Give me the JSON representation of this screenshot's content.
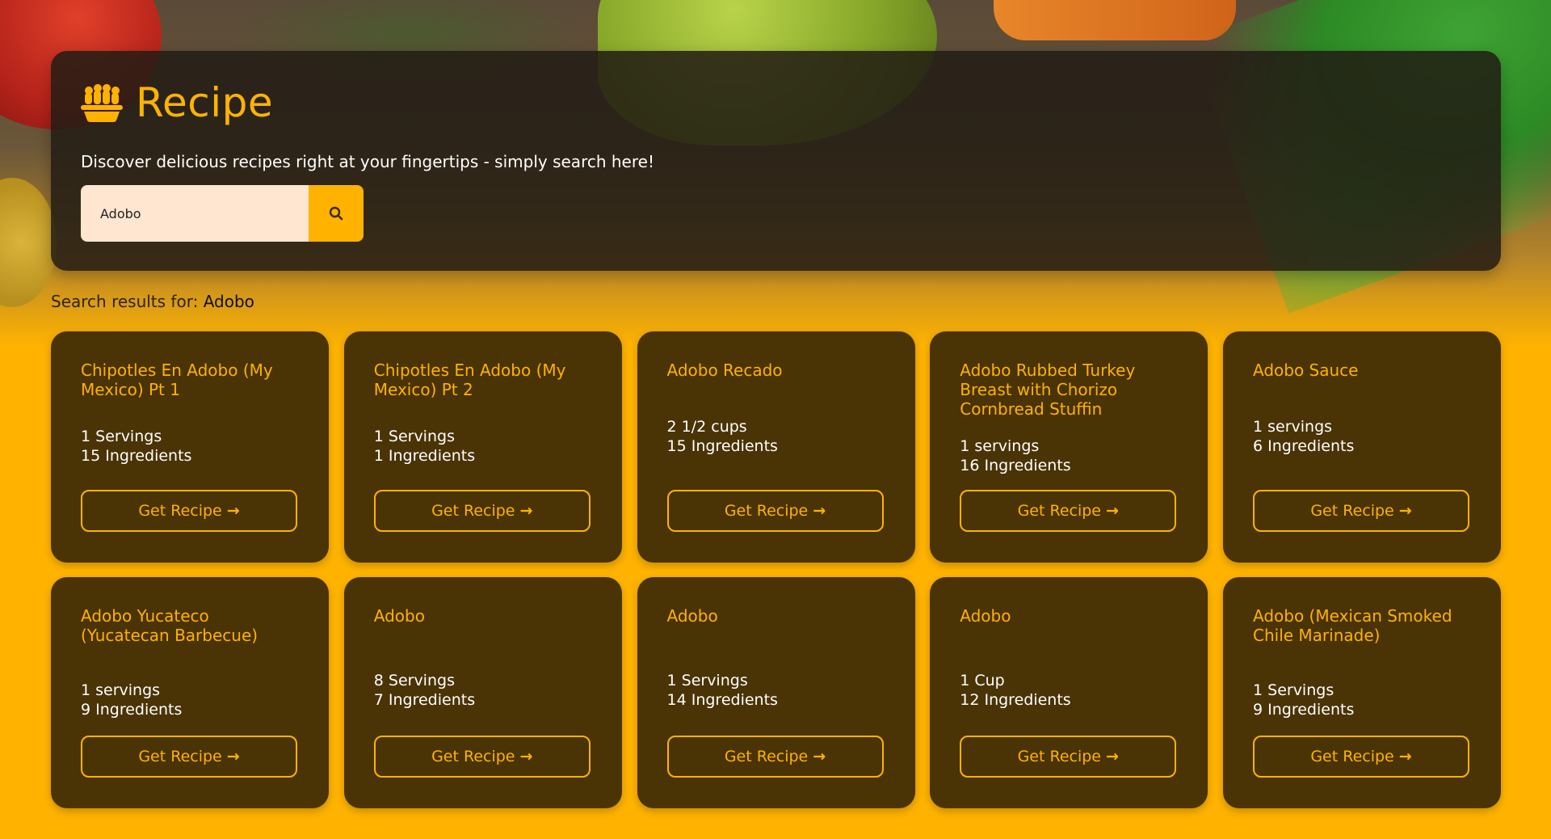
{
  "header": {
    "title": "Recipe",
    "tagline": "Discover delicious recipes right at your fingertips - simply search here!"
  },
  "search": {
    "value": "Adobo",
    "icon": "search-icon"
  },
  "results": {
    "label": "Search results for:",
    "term": "Adobo"
  },
  "colors": {
    "accent": "#FFB300",
    "card": "#4A3305",
    "hero": "#221C14",
    "input": "#FFE6D1"
  },
  "cards": [
    {
      "title": "Chipotles En Adobo (My Mexico) Pt 1",
      "servings": "1 Servings",
      "ingredients": "15 Ingredients",
      "button": "Get Recipe"
    },
    {
      "title": "Chipotles En Adobo (My Mexico) Pt 2",
      "servings": "1 Servings",
      "ingredients": "1 Ingredients",
      "button": "Get Recipe"
    },
    {
      "title": "Adobo Recado",
      "servings": "2 1/2 cups",
      "ingredients": "15 Ingredients",
      "button": "Get Recipe"
    },
    {
      "title": "Adobo Rubbed Turkey Breast with Chorizo Cornbread Stuffin",
      "servings": "1 servings",
      "ingredients": "16 Ingredients",
      "button": "Get Recipe"
    },
    {
      "title": "Adobo Sauce",
      "servings": "1 servings",
      "ingredients": "6 Ingredients",
      "button": "Get Recipe"
    },
    {
      "title": "Adobo Yucateco (Yucatecan Barbecue)",
      "servings": "1 servings",
      "ingredients": "9 Ingredients",
      "button": "Get Recipe"
    },
    {
      "title": "Adobo",
      "servings": "8 Servings",
      "ingredients": "7 Ingredients",
      "button": "Get Recipe"
    },
    {
      "title": "Adobo",
      "servings": "1 Servings",
      "ingredients": "14 Ingredients",
      "button": "Get Recipe"
    },
    {
      "title": "Adobo",
      "servings": "1 Cup",
      "ingredients": "12 Ingredients",
      "button": "Get Recipe"
    },
    {
      "title": "Adobo (Mexican Smoked Chile Marinade)",
      "servings": "1 Servings",
      "ingredients": "9 Ingredients",
      "button": "Get Recipe"
    }
  ]
}
